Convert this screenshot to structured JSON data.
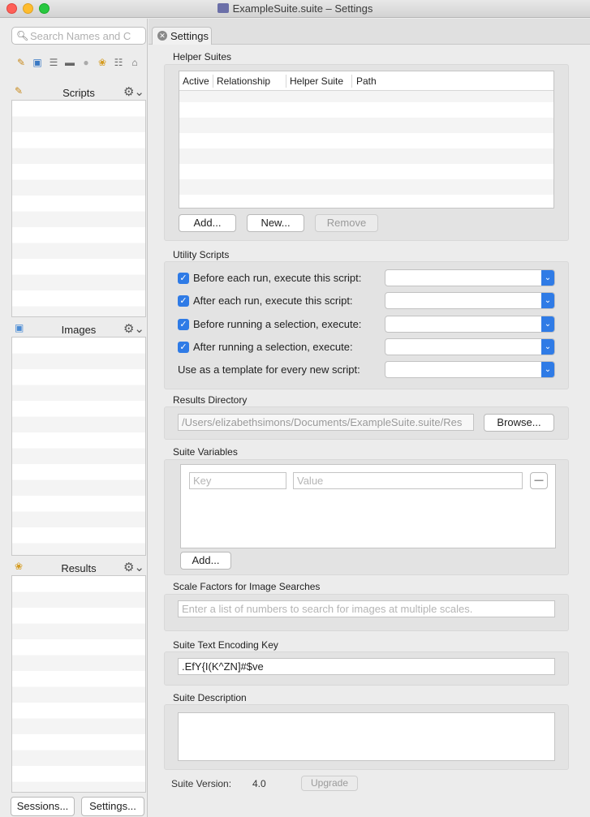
{
  "window": {
    "title": "ExampleSuite.suite – Settings"
  },
  "sidebar": {
    "search_placeholder": "Search Names and C",
    "toolbar_icons": [
      "script-icon",
      "camera-icon",
      "table-icon",
      "toggle-icon",
      "sphere-icon",
      "ribbon-icon",
      "clipboard-icon",
      "cart-icon"
    ],
    "panels": [
      {
        "title": "Scripts",
        "icon": "script-icon"
      },
      {
        "title": "Images",
        "icon": "camera-icon"
      },
      {
        "title": "Results",
        "icon": "ribbon-icon"
      }
    ],
    "sessions_button": "Sessions...",
    "settings_button": "Settings..."
  },
  "tabs": [
    {
      "label": "Settings",
      "active": true
    }
  ],
  "helper_suites": {
    "title": "Helper Suites",
    "columns": [
      "Active",
      "Relationship",
      "Helper Suite",
      "Path"
    ],
    "add_label": "Add...",
    "new_label": "New...",
    "remove_label": "Remove"
  },
  "utility_scripts": {
    "title": "Utility Scripts",
    "rows": [
      {
        "label": "Before each run, execute this script:",
        "checked": true
      },
      {
        "label": "After each run, execute this script:",
        "checked": true
      },
      {
        "label": "Before running a selection, execute:",
        "checked": true
      },
      {
        "label": "After running a selection, execute:",
        "checked": true
      }
    ],
    "template_label": "Use as a template for every new script:"
  },
  "results_directory": {
    "title": "Results Directory",
    "path": "/Users/elizabethsimons/Documents/ExampleSuite.suite/Res",
    "browse_label": "Browse..."
  },
  "suite_variables": {
    "title": "Suite Variables",
    "key_placeholder": "Key",
    "value_placeholder": "Value",
    "remove_label": "—",
    "add_label": "Add..."
  },
  "scale_factors": {
    "title": "Scale Factors for Image Searches",
    "placeholder": "Enter a list of numbers to search for images at multiple scales."
  },
  "encoding_key": {
    "title": "Suite Text Encoding Key",
    "value": ".EfY{I(K^ZN]#$ve"
  },
  "description": {
    "title": "Suite Description",
    "value": ""
  },
  "footer": {
    "version_label": "Suite Version:",
    "version_value": "4.0",
    "upgrade_label": "Upgrade"
  },
  "colors": {
    "accent": "#2f7be6",
    "close": "#fe5f57",
    "minimize": "#febc2e",
    "maximize": "#28c840"
  }
}
